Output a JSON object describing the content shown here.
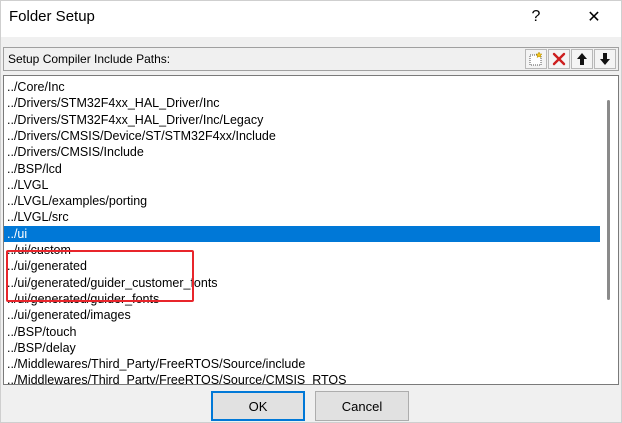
{
  "window": {
    "title": "Folder Setup",
    "help_glyph": "?",
    "close_glyph": "✕"
  },
  "group": {
    "label": "Setup Compiler Include Paths:"
  },
  "toolbar": {
    "new_icon": "new-folder-icon",
    "delete_icon": "delete-icon",
    "move_up_icon": "arrow-up-icon",
    "move_down_icon": "arrow-down-icon",
    "delete_color": "#cc1f1f"
  },
  "paths": [
    "../Core/Inc",
    "../Drivers/STM32F4xx_HAL_Driver/Inc",
    "../Drivers/STM32F4xx_HAL_Driver/Inc/Legacy",
    "../Drivers/CMSIS/Device/ST/STM32F4xx/Include",
    "../Drivers/CMSIS/Include",
    "../BSP/lcd",
    "../LVGL",
    "../LVGL/examples/porting",
    "../LVGL/src",
    "../ui",
    "../ui/custom",
    "../ui/generated",
    "../ui/generated/guider_customer_fonts",
    "../ui/generated/guider_fonts",
    "../ui/generated/images",
    "../BSP/touch",
    "../BSP/delay",
    "../Middlewares/Third_Party/FreeRTOS/Source/include",
    "../Middlewares/Third_Party/FreeRTOS/Source/CMSIS_RTOS"
  ],
  "selected_path": "../ui",
  "annotation": {
    "color": "#e8252b",
    "highlighted_paths": [
      "../LVGL",
      "../LVGL/examples/porting",
      "../LVGL/src"
    ]
  },
  "buttons": {
    "ok_label": "OK",
    "cancel_label": "Cancel"
  },
  "colors": {
    "selection": "#0078d7",
    "dialog_bg": "#f0f0f0"
  }
}
